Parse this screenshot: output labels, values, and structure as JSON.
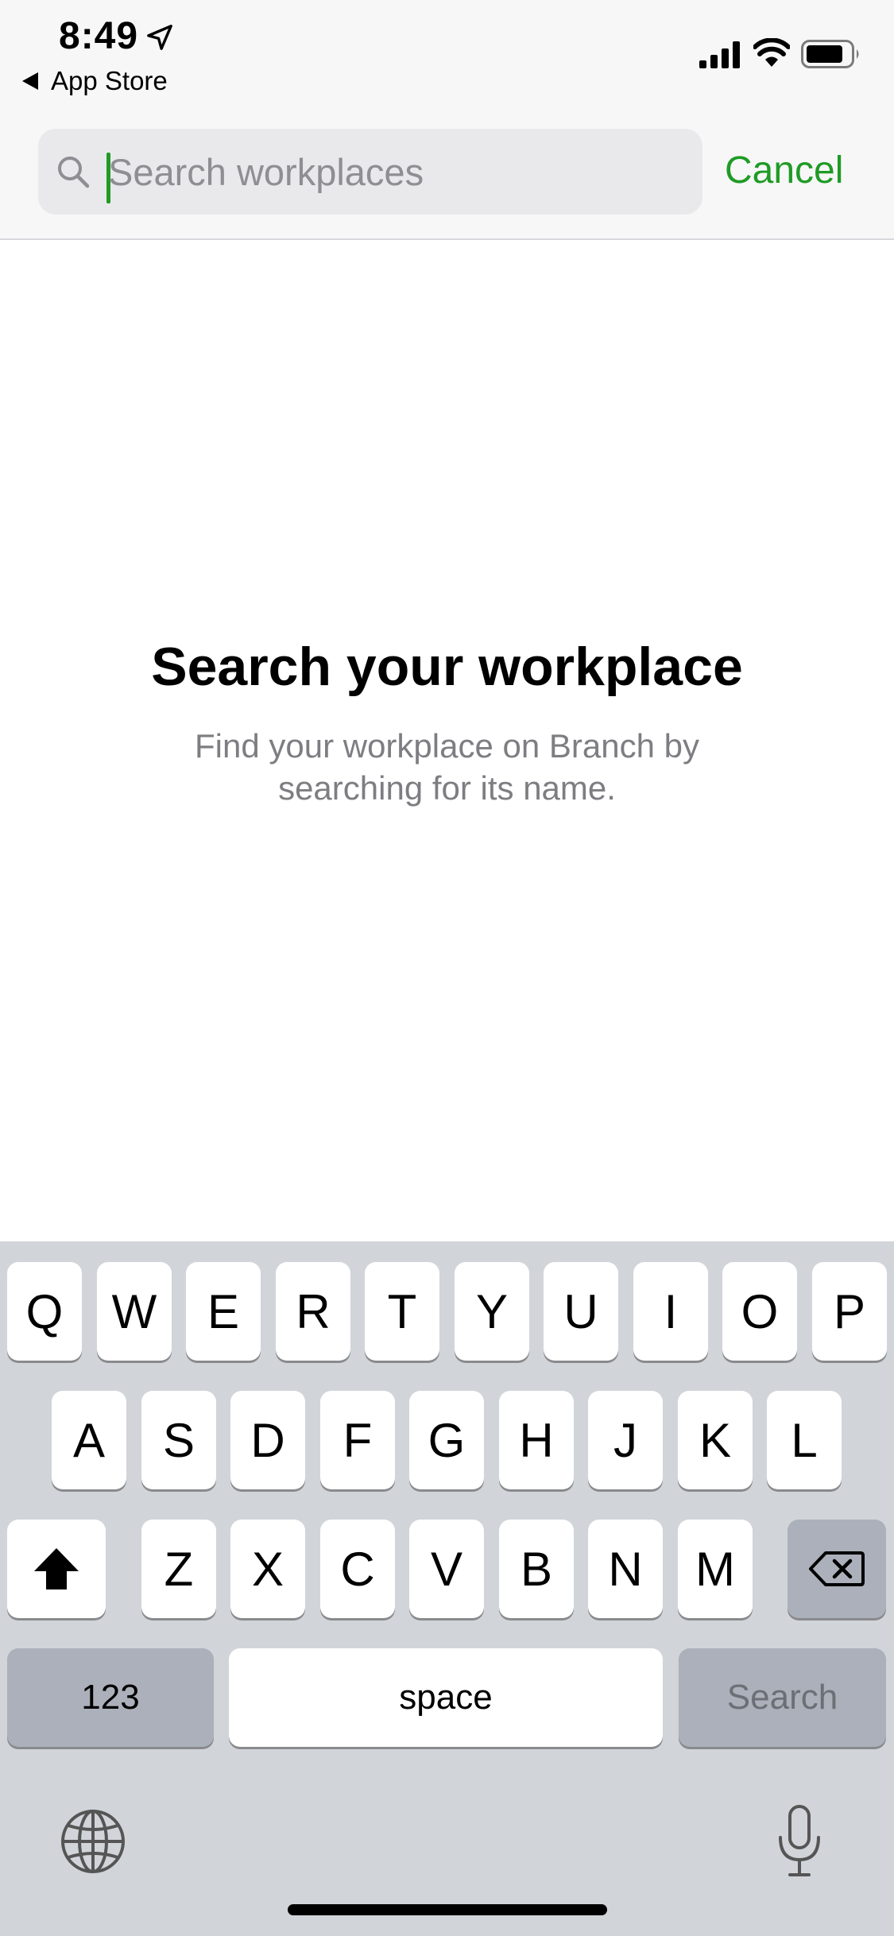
{
  "status_bar": {
    "time": "8:49",
    "back_app": "App Store",
    "icons": [
      "location-arrow-icon",
      "signal-bars-icon",
      "wifi-icon",
      "battery-icon"
    ]
  },
  "search": {
    "placeholder": "Search workplaces",
    "value": "",
    "cancel_label": "Cancel",
    "accent_color": "#1f9b25"
  },
  "empty_state": {
    "title": "Search your workplace",
    "subtitle": "Find your workplace on Branch by searching for its name."
  },
  "keyboard": {
    "row1": [
      "Q",
      "W",
      "E",
      "R",
      "T",
      "Y",
      "U",
      "I",
      "O",
      "P"
    ],
    "row2": [
      "A",
      "S",
      "D",
      "F",
      "G",
      "H",
      "J",
      "K",
      "L"
    ],
    "row3": [
      "Z",
      "X",
      "C",
      "V",
      "B",
      "N",
      "M"
    ],
    "numbers_label": "123",
    "space_label": "space",
    "return_label": "Search",
    "icons": [
      "shift-icon",
      "delete-icon",
      "globe-icon",
      "microphone-icon"
    ]
  }
}
